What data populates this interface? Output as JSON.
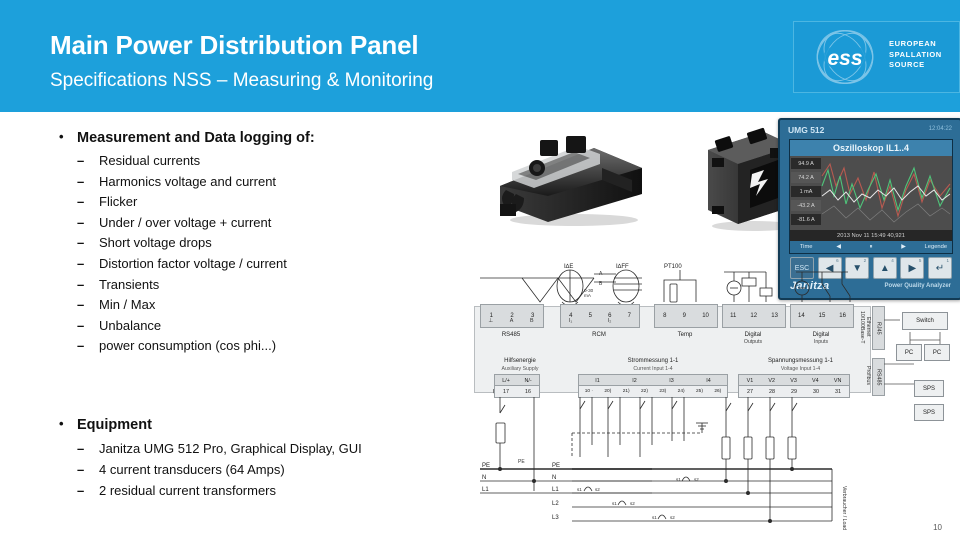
{
  "header": {
    "title": "Main Power Distribution Panel",
    "subtitle": "Specifications NSS – Measuring & Monitoring",
    "logo": {
      "mark": "ess-logo-icon",
      "line1": "EUROPEAN",
      "line2": "SPALLATION",
      "line3": "SOURCE"
    },
    "bg_color": "#1da0db"
  },
  "content": {
    "section1": {
      "heading": "Measurement and Data logging of:",
      "bullet_char": "•",
      "dash_char": "–",
      "items": [
        "Residual currents",
        "Harmonics voltage and current",
        "Flicker",
        "Under / over voltage + current",
        "Short voltage drops",
        "Distortion factor voltage / current",
        "Transients",
        "Min / Max",
        "Unbalance",
        "power consumption (cos phi...)"
      ]
    },
    "section2": {
      "heading": "Equipment",
      "bullet_char": "•",
      "dash_char": "–",
      "items": [
        "Janitza UMG 512 Pro, Graphical Display, GUI",
        "4 current transducers (64 Amps)",
        "2 residual current transformers"
      ]
    }
  },
  "photos": [
    {
      "name": "umg-512-module-photo",
      "caption": ""
    },
    {
      "name": "current-transformer-photo",
      "caption": ""
    }
  ],
  "display_panel": {
    "model": "UMG 512",
    "corner_text": "12:04:22",
    "screen_title": "Oszilloskop IL1..4",
    "y_labels": [
      "94.9 A",
      "74.2 A",
      "1 mA",
      "-43.2 A",
      "-81.6 A"
    ],
    "status_text": "2013 Nov 11 15:49  40,921",
    "softkeys": [
      "Time",
      "◀",
      "⏸",
      "▶",
      "Legende"
    ],
    "buttons": [
      {
        "name": "esc-button",
        "glyph": "ESC",
        "sup": ""
      },
      {
        "name": "left-arrow-button",
        "glyph": "◀",
        "sup": "6"
      },
      {
        "name": "down-arrow-button",
        "glyph": "▼",
        "sup": "2"
      },
      {
        "name": "up-arrow-button",
        "glyph": "▲",
        "sup": "4"
      },
      {
        "name": "right-arrow-button",
        "glyph": "▶",
        "sup": "5"
      },
      {
        "name": "enter-button",
        "glyph": "↵",
        "sup": "1"
      }
    ],
    "brand": "Janitza",
    "tagline": "Power Quality Analyzer",
    "trace_colors": [
      "#4fc47a",
      "#c0564e",
      "#e6e6e6"
    ]
  },
  "diagram": {
    "device_name": "UMG 512",
    "terminal_groups": [
      {
        "numbers": [
          "1",
          "2",
          "3"
        ],
        "sublabels": [
          "⊥",
          "A",
          "B"
        ],
        "title": "RS485",
        "subtitle": ""
      },
      {
        "numbers": [
          "4",
          "5",
          "6",
          "7"
        ],
        "sublabels": [
          "I₁",
          "",
          "I₂",
          ""
        ],
        "title": "RCM",
        "subtitle": ""
      },
      {
        "numbers": [
          "8",
          "9",
          "10"
        ],
        "sublabels": [
          "",
          "",
          ""
        ],
        "title": "Temp",
        "subtitle": ""
      },
      {
        "numbers": [
          "11",
          "12",
          "13"
        ],
        "sublabels": [
          "",
          "",
          ""
        ],
        "title": "Digital",
        "subtitle": "Outputs"
      },
      {
        "numbers": [
          "14",
          "15",
          "16"
        ],
        "sublabels": [
          "",
          "",
          ""
        ],
        "title": "Digital",
        "subtitle": "Inputs"
      }
    ],
    "symbol_labels": [
      "I∆E",
      "I∆FF",
      "PT100"
    ],
    "bottom_groups": [
      {
        "title": "Hilfsenergie",
        "subtitle": "Auxiliary Supply",
        "terminals": [
          "L/+",
          "N/-"
        ],
        "numbers": [
          "17",
          "16"
        ]
      },
      {
        "title": "Strommessung 1-1",
        "subtitle": "Current Input 1-4",
        "terminals": [
          "I1",
          "I2",
          "I3",
          "I4"
        ],
        "numbers": [
          "10 ·",
          "20)",
          "21)",
          "22)",
          "23)",
          "24)",
          "25)",
          "26)"
        ]
      },
      {
        "title": "Spannungsmessung 1-1",
        "subtitle": "Voltage Input 1-4",
        "terminals": [
          "V1",
          "V2",
          "V3",
          "V4",
          "VN"
        ],
        "numbers": [
          "27",
          "28",
          "29",
          "30",
          "31"
        ]
      }
    ],
    "side_ports": [
      {
        "tag": "RJ45",
        "label": "Ethernet 10/100Base-T"
      },
      {
        "tag": "RS485",
        "label": "Profibus"
      }
    ],
    "network_boxes": [
      "Switch",
      "PC",
      "PC",
      "SPS",
      "SPS"
    ],
    "phase_labels": [
      "PE",
      "N",
      "L1",
      "L2",
      "L3"
    ],
    "aux_phase_labels": [
      "PE",
      "N",
      "L1"
    ],
    "load_label": "Verbraucher / Load",
    "ct_labels": [
      "s1",
      "s2"
    ],
    "pe_label": "PE"
  },
  "footer": {
    "page_number": "10"
  }
}
